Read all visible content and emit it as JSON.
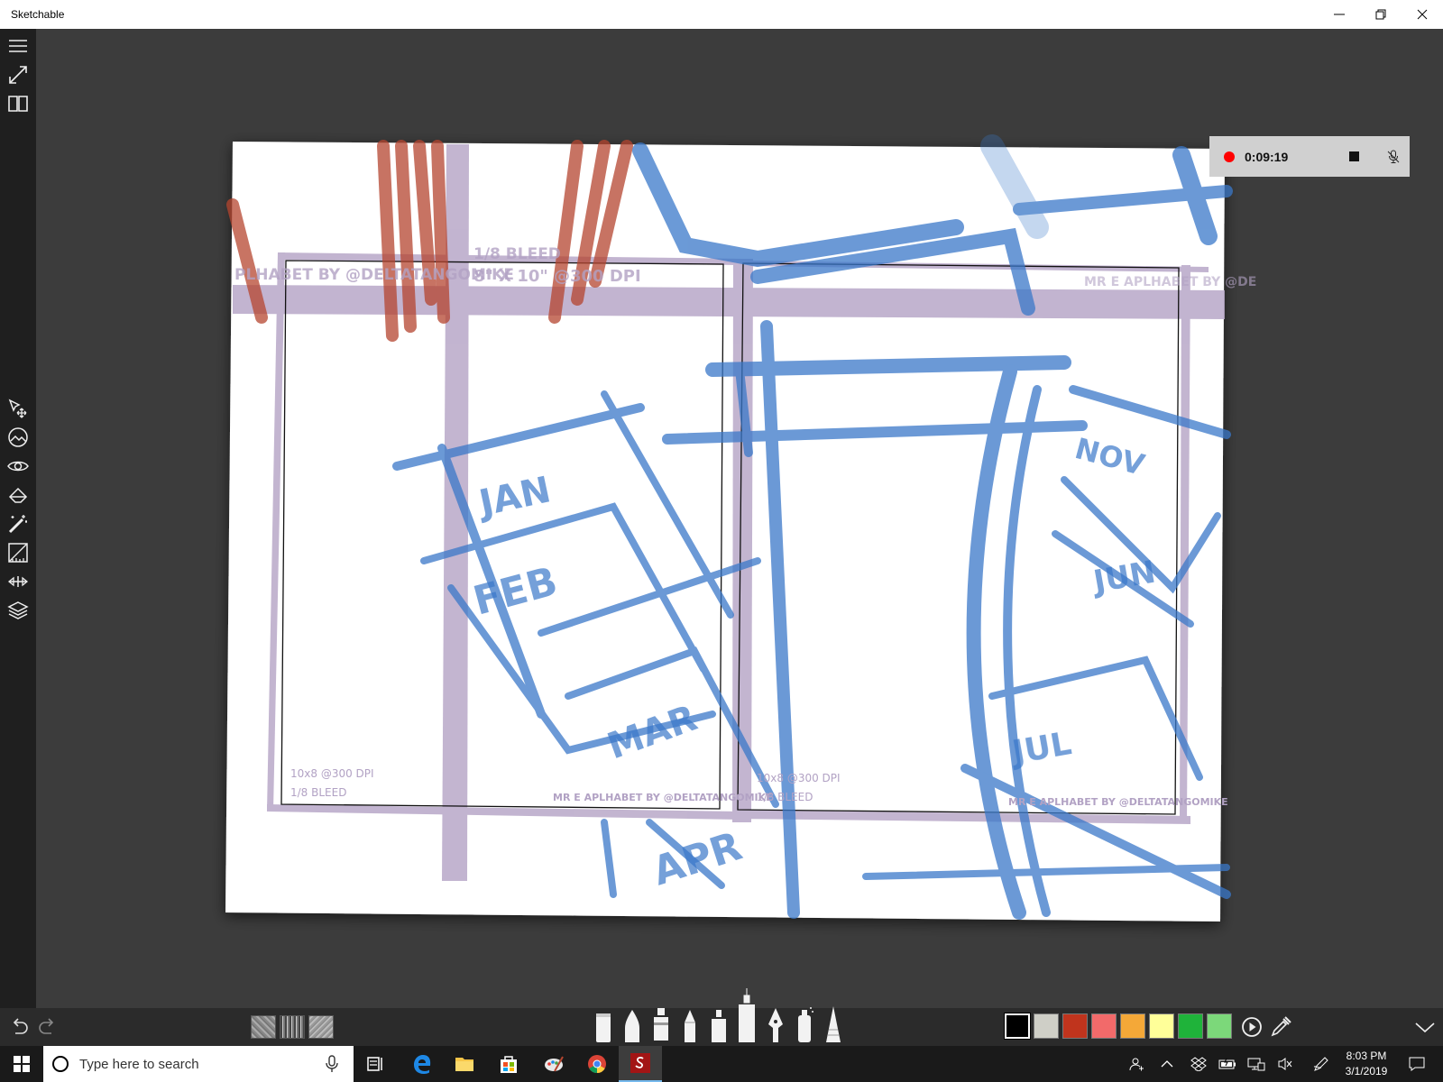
{
  "window": {
    "title": "Sketchable",
    "minimize_icon": "minimize-icon",
    "restore_icon": "restore-icon",
    "close_icon": "close-icon"
  },
  "left_toolbar": {
    "top_tools": [
      "menu-icon",
      "fullscreen-icon",
      "journal-icon"
    ],
    "tools": [
      "select-move-icon",
      "color-adjust-icon",
      "visibility-icon",
      "fill-icon",
      "magic-wand-icon",
      "ruler-icon",
      "symmetry-icon",
      "layers-icon"
    ]
  },
  "canvas": {
    "panel_left": {
      "size_text": "10x8  @300 DPI",
      "bleed_text": "1/8  BLEED",
      "credit_text": "MR E APLHABET BY @DELTATANGOMIKE"
    },
    "panel_right": {
      "size_text": "10x8  @300 DPI",
      "bleed_text": "1/8  BLEED",
      "credit_text": "MR E APLHABET BY @DELTATANGOMIKE"
    },
    "top_strip": {
      "credit_left": "PLHABET BY @DELTATANGOMIKE",
      "bleed": "1/8  BLEED",
      "dims": "8\" X 10\" @300 DPI",
      "credit_right": "MR E APLHABET BY @DE"
    },
    "sketch_labels": [
      "JAN",
      "FEB",
      "MAR",
      "APR",
      "NOV",
      "JUN",
      "JUL"
    ],
    "sketch_colors": {
      "blue": "#3a78c9",
      "red": "#b5452f",
      "guide": "#b8a8c8"
    }
  },
  "recorder": {
    "time": "0:09:19",
    "record_icon": "record-icon",
    "stop_icon": "stop-icon",
    "mic_icon": "mic-muted-icon"
  },
  "bottom_toolbar": {
    "undo_icon": "undo-icon",
    "redo_icon": "redo-icon",
    "textures": [
      "texture-rough",
      "texture-noise",
      "texture-grain"
    ],
    "brushes": [
      "marker",
      "ink-pen",
      "paint-tube",
      "pencil",
      "highlighter",
      "airbrush",
      "fountain-pen",
      "spray-can",
      "crayon"
    ],
    "swatches": [
      "#000000",
      "#cfcfc7",
      "#c0341d",
      "#f26a6a",
      "#f4a838",
      "#ffff99",
      "#1fb33a",
      "#7cd87a"
    ],
    "play_icon": "play-icon",
    "eyedropper_icon": "eyedropper-icon",
    "collapse_icon": "chevron-down-icon"
  },
  "taskbar": {
    "search_placeholder": "Type here to search",
    "apps": [
      "task-view-icon",
      "edge-icon",
      "file-explorer-icon",
      "store-icon",
      "paint-icon",
      "chrome-icon",
      "sketchable-icon"
    ],
    "tray": [
      "people-icon",
      "chevron-up-icon",
      "dropbox-icon",
      "battery-icon",
      "network-icon",
      "volume-muted-icon",
      "pen-icon"
    ],
    "time": "8:03 PM",
    "date": "3/1/2019"
  }
}
